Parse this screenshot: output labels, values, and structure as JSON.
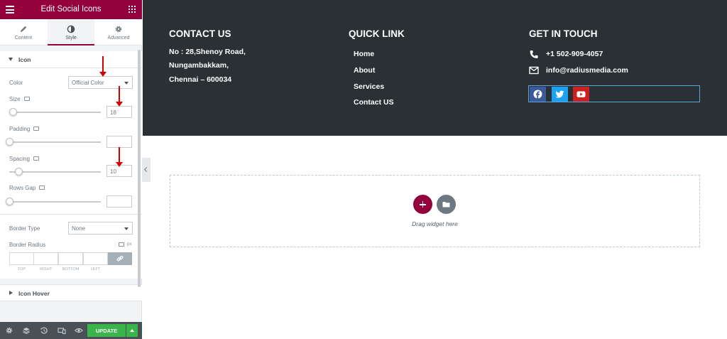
{
  "panel": {
    "header_title": "Edit Social Icons",
    "tabs": [
      {
        "label": "Content",
        "icon": "pencil-icon"
      },
      {
        "label": "Style",
        "icon": "contrast-icon",
        "active": true
      },
      {
        "label": "Advanced",
        "icon": "gear-icon"
      }
    ],
    "icon_section": {
      "title": "Icon",
      "color_label": "Color",
      "color_value": "Official Color",
      "size_label": "Size",
      "size_value": "18",
      "padding_label": "Padding",
      "padding_value": "",
      "spacing_label": "Spacing",
      "spacing_value": "10",
      "rows_gap_label": "Rows Gap",
      "rows_gap_value": "",
      "border_type_label": "Border Type",
      "border_type_value": "None",
      "border_radius_label": "Border Radius",
      "border_radius_unit": "px",
      "border_radius_fields": [
        "TOP",
        "RIGHT",
        "BOTTOM",
        "LEFT"
      ]
    },
    "icon_hover_section": {
      "title": "Icon Hover"
    },
    "update_label": "UPDATE",
    "accent_color": "#93003c",
    "update_color": "#39b54a"
  },
  "site": {
    "contact": {
      "title": "CONTACT US",
      "lines": [
        "No : 28,Shenoy Road,",
        "Nungambakkam,",
        "Chennai – 600034"
      ]
    },
    "quick_link": {
      "title": "QUICK LINK",
      "links": [
        "Home",
        "About",
        "Services",
        "Contact US"
      ]
    },
    "get_in_touch": {
      "title": "GET IN TOUCH",
      "phone": "+1 502-909-4057",
      "email": "info@radiusmedia.com",
      "social": [
        {
          "name": "facebook",
          "icon": "facebook-icon",
          "color": "#3b5998"
        },
        {
          "name": "twitter",
          "icon": "twitter-icon",
          "color": "#1da1f2"
        },
        {
          "name": "youtube",
          "icon": "youtube-icon",
          "color": "#cd201f"
        }
      ]
    },
    "footer_bg": "#2b3035"
  },
  "canvas": {
    "drag_text": "Drag widget here"
  }
}
